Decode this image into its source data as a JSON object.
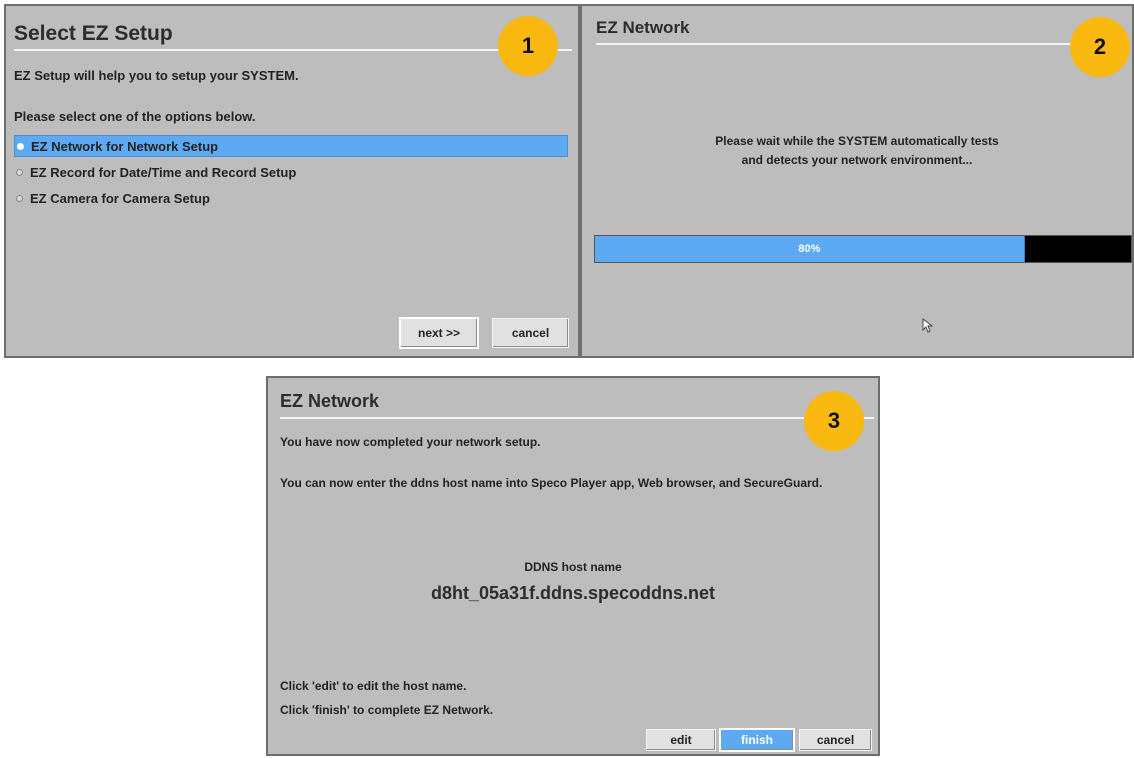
{
  "panel1": {
    "title": "Select EZ Setup",
    "badge": "1",
    "intro": "EZ Setup will help you to setup your SYSTEM.",
    "prompt": "Please select one of the options below.",
    "options": [
      {
        "label": "EZ Network for Network Setup",
        "selected": true
      },
      {
        "label": "EZ Record for Date/Time and Record Setup",
        "selected": false
      },
      {
        "label": "EZ Camera for Camera Setup",
        "selected": false
      }
    ],
    "next_label": "next >>",
    "cancel_label": "cancel"
  },
  "panel2": {
    "title": "EZ Network",
    "badge": "2",
    "message_line1": "Please wait while the SYSTEM automatically tests",
    "message_line2": "and detects your network environment...",
    "progress_label": "80%",
    "progress": 0.8
  },
  "panel3": {
    "title": "EZ Network",
    "badge": "3",
    "line1": "You have now completed your network setup.",
    "line2": "You can now enter the ddns host name into Speco Player app, Web browser, and SecureGuard.",
    "host_caption": "DDNS host name",
    "host_value": "d8ht_05a31f.ddns.specoddns.net",
    "hint1": "Click 'edit' to edit the host name.",
    "hint2": "Click 'finish' to complete EZ Network.",
    "edit_label": "edit",
    "finish_label": "finish",
    "cancel_label": "cancel"
  },
  "colors": {
    "panel_bg": "#bdbdbd",
    "selection": "#5eaaf2",
    "badge": "#f9b911",
    "progress_empty": "#000000"
  }
}
